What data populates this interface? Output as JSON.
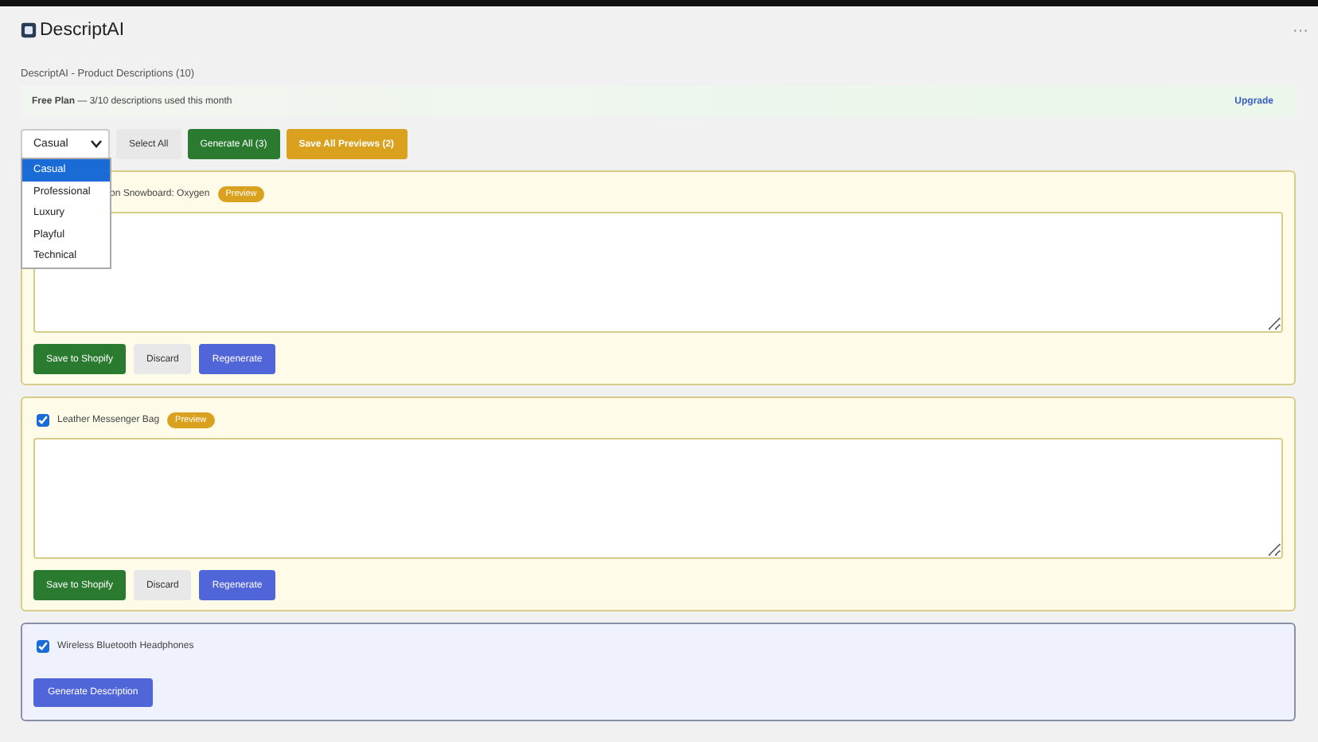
{
  "app": {
    "title": "DescriptAI",
    "menu": "···"
  },
  "heading": "DescriptAI - Product Descriptions (10)",
  "plan": {
    "name": "Free Plan",
    "text": " — 3/10 descriptions used this month",
    "link": "Upgrade"
  },
  "toolbar": {
    "tone": {
      "value": "Casual",
      "expanded": true,
      "options": [
        {
          "label": "Casual",
          "selected": true
        },
        {
          "label": "Professional",
          "selected": false
        },
        {
          "label": "Luxury",
          "selected": false
        },
        {
          "label": "Playful",
          "selected": false
        },
        {
          "label": "Technical",
          "selected": false
        }
      ]
    },
    "select_all": "Select All",
    "generate_all": "Generate All (3)",
    "save_all": "Save All Previews (2)"
  },
  "products": [
    {
      "kind": "preview",
      "title": "on Snowboard: Oxygen",
      "badge": "Preview",
      "buttons": [
        "Save to Shopify",
        "Discard",
        "Regenerate"
      ]
    },
    {
      "kind": "preview",
      "checked": true,
      "title": "Leather Messenger Bag",
      "badge": "Preview",
      "buttons": [
        "Save to Shopify",
        "Discard",
        "Regenerate"
      ]
    },
    {
      "kind": "pending",
      "checked": true,
      "title": "Wireless Bluetooth Headphones",
      "buttons": [
        "Generate Description"
      ]
    }
  ]
}
